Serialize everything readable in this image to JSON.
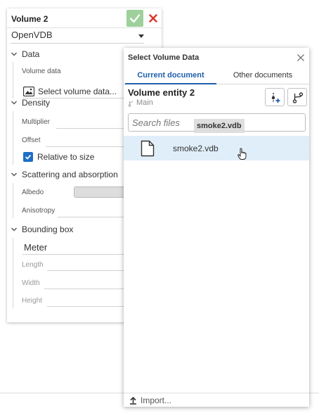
{
  "panel": {
    "title": "Volume 2",
    "type_value": "OpenVDB",
    "sections": {
      "data": "Data",
      "density": "Density",
      "scattering": "Scattering and absorption",
      "bounding": "Bounding box"
    },
    "fields": {
      "volume_data_label": "Volume data",
      "volume_data_value": "Select volume data...",
      "multiplier": "Multiplier",
      "offset": "Offset",
      "relative_to_size": "Relative to size",
      "relative_to_size_checked": true,
      "albedo": "Albedo",
      "anisotropy": "Anisotropy",
      "units_value": "Meter",
      "length": "Length",
      "width": "Width",
      "height": "Height"
    },
    "colors": {
      "accept": "#9dd09b",
      "cancel": "#d9342b",
      "checkbox": "#1f6fc5"
    }
  },
  "dialog": {
    "title": "Select Volume Data",
    "tabs": [
      {
        "label": "Current document",
        "active": true
      },
      {
        "label": "Other documents",
        "active": false
      }
    ],
    "document_title": "Volume entity 2",
    "branch": "Main",
    "search_placeholder": "Search files",
    "drag_tooltip": "smoke2.vdb",
    "files": [
      {
        "name": "smoke2.vdb",
        "icon": "document-icon",
        "highlighted": true
      }
    ],
    "import_label": "Import...",
    "colors": {
      "active_tab": "#1f5fad",
      "row_highlight": "#dfeef9"
    }
  }
}
